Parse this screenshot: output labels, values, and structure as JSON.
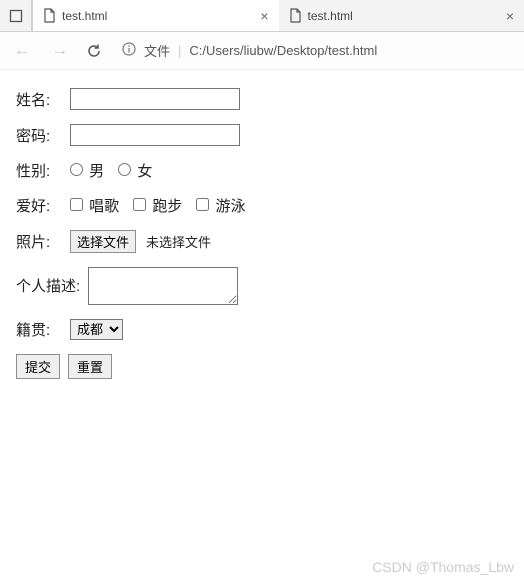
{
  "tabs": [
    {
      "title": "test.html"
    },
    {
      "title": "test.html"
    }
  ],
  "addressbar": {
    "protocol_label": "文件",
    "path": "C:/Users/liubw/Desktop/test.html"
  },
  "form": {
    "name_label": "姓名:",
    "password_label": "密码:",
    "gender_label": "性别:",
    "gender_options": {
      "male": "男",
      "female": "女"
    },
    "hobby_label": "爱好:",
    "hobby_options": {
      "sing": "唱歌",
      "run": "跑步",
      "swim": "游泳"
    },
    "photo_label": "照片:",
    "file_button": "选择文件",
    "file_status": "未选择文件",
    "desc_label": "个人描述:",
    "origin_label": "籍贯:",
    "origin_selected": "成都",
    "submit": "提交",
    "reset": "重置"
  },
  "watermark": "CSDN @Thomas_Lbw"
}
